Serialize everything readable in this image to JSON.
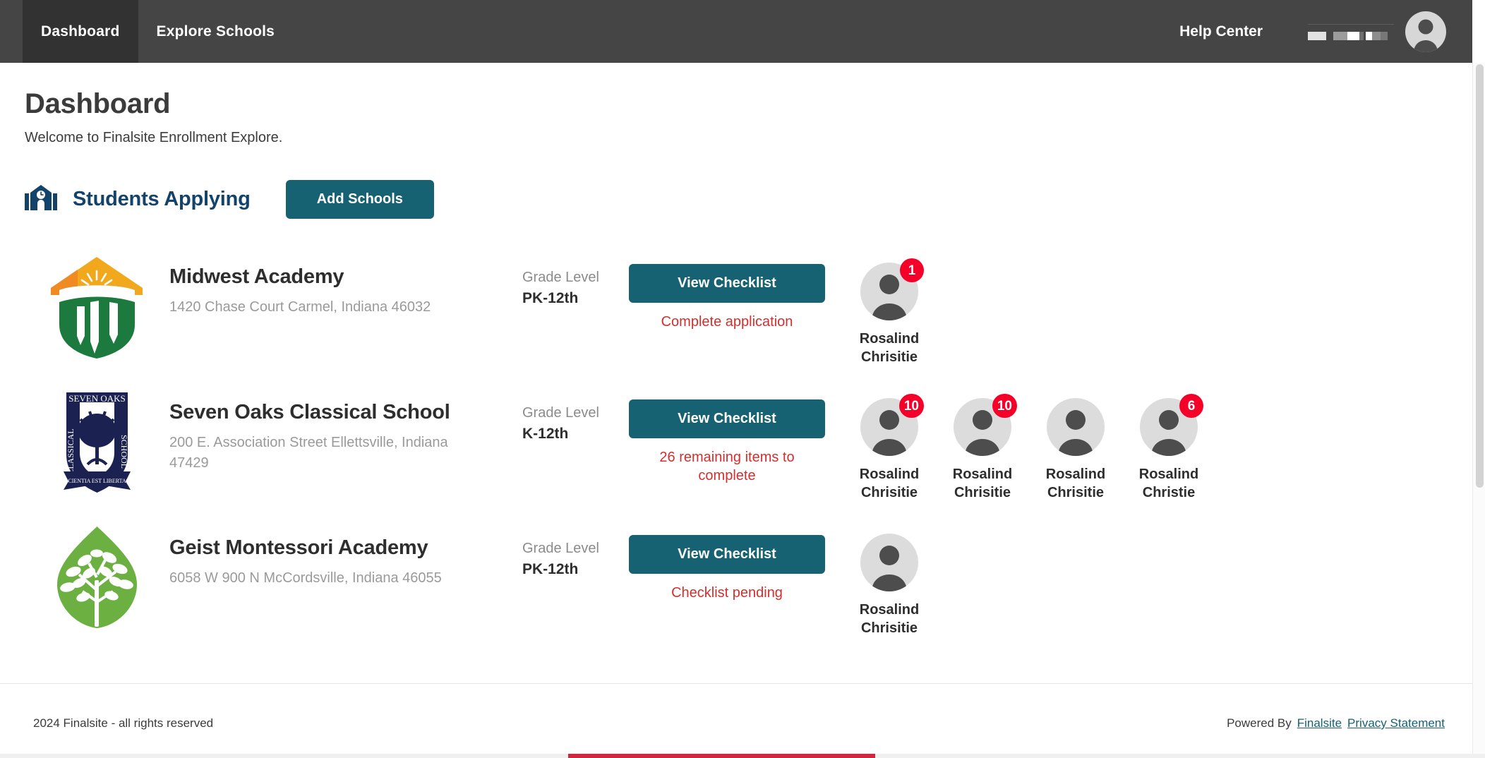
{
  "nav": {
    "items": [
      {
        "label": "Dashboard",
        "active": true
      },
      {
        "label": "Explore Schools",
        "active": false
      }
    ],
    "help_center": "Help Center",
    "user_name_redacted": "",
    "avatar_icon": "user-avatar-icon"
  },
  "page": {
    "title": "Dashboard",
    "subtitle": "Welcome to Finalsite Enrollment Explore."
  },
  "section": {
    "icon": "school-building-clock-icon",
    "title": "Students Applying",
    "add_schools_label": "Add Schools"
  },
  "labels": {
    "grade_level": "Grade Level",
    "view_checklist": "View Checklist"
  },
  "colors": {
    "nav_bg": "#454545",
    "nav_active_bg": "#323232",
    "teal": "#166273",
    "section_title": "#13436b",
    "status_red": "#d32f2f",
    "badge_red": "#f50028",
    "bottom_red": "#cf2740"
  },
  "schools": [
    {
      "name": "Midwest Academy",
      "address": "1420 Chase Court Carmel, Indiana 46032",
      "grade_label": "Grade Level",
      "grade_level": "PK-12th",
      "checklist_button": "View Checklist",
      "status": "Complete application",
      "logo_icon": "midwest-academy-shield-logo",
      "students": [
        {
          "name": "Rosalind Chrisitie",
          "badge": "1"
        }
      ]
    },
    {
      "name": "Seven Oaks Classical School",
      "address": "200 E. Association Street Ellettsville, Indiana 47429",
      "grade_label": "Grade Level",
      "grade_level": "K-12th",
      "checklist_button": "View Checklist",
      "status": "26 remaining items to complete",
      "logo_icon": "seven-oaks-classical-crest-logo",
      "students": [
        {
          "name": "Rosalind Chrisitie",
          "badge": "10"
        },
        {
          "name": "Rosalind Chrisitie",
          "badge": "10"
        },
        {
          "name": "Rosalind Chrisitie",
          "badge": ""
        },
        {
          "name": "Rosalind Christie",
          "badge": "6"
        }
      ]
    },
    {
      "name": "Geist Montessori Academy",
      "address": "6058 W 900 N McCordsville, Indiana 46055",
      "grade_label": "Grade Level",
      "grade_level": "PK-12th",
      "checklist_button": "View Checklist",
      "status": "Checklist pending",
      "logo_icon": "geist-montessori-leaf-tree-logo",
      "students": [
        {
          "name": "Rosalind Chrisitie",
          "badge": ""
        }
      ]
    }
  ],
  "footer": {
    "copyright": "2024 Finalsite - all rights reserved",
    "powered_by": "Powered By",
    "finalsite_link": "Finalsite",
    "privacy_link": "Privacy Statement"
  }
}
